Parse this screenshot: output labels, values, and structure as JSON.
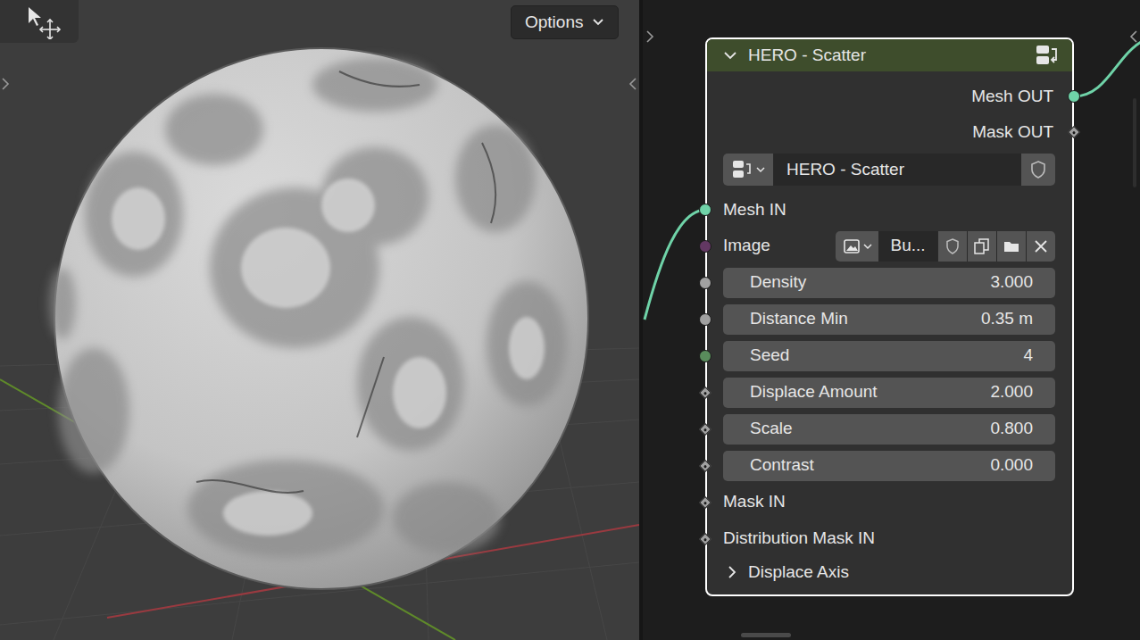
{
  "viewport": {
    "options": {
      "label": "Options"
    }
  },
  "node": {
    "title": "HERO - Scatter",
    "expanded": true,
    "selected": true,
    "outputs": [
      {
        "label": "Mesh OUT",
        "socket": "circle",
        "color": "#6fd3a8",
        "linked": true
      },
      {
        "label": "Mask OUT",
        "socket": "diamond",
        "color": "#a1a1a1",
        "linked": false
      }
    ],
    "group": {
      "name": "HERO - Scatter"
    },
    "inputs": [
      {
        "label": "Mesh IN",
        "kind": "socket",
        "socket": "circle",
        "color": "#6fd3a8",
        "linked": true
      },
      {
        "label": "Image",
        "kind": "image",
        "socket": "circle",
        "color": "#633863",
        "value": "Bu...",
        "linked": false
      },
      {
        "label": "Density",
        "kind": "field",
        "socket": "circle",
        "color": "#a1a1a1",
        "value": "3.000",
        "linked": false
      },
      {
        "label": "Distance Min",
        "kind": "field",
        "socket": "circle",
        "color": "#a1a1a1",
        "value": "0.35 m",
        "linked": false
      },
      {
        "label": "Seed",
        "kind": "field",
        "socket": "circle",
        "color": "#598c5c",
        "value": "4",
        "linked": false
      },
      {
        "label": "Displace Amount",
        "kind": "field",
        "socket": "diamond",
        "color": "#a1a1a1",
        "value": "2.000",
        "linked": false
      },
      {
        "label": "Scale",
        "kind": "field",
        "socket": "diamond",
        "color": "#a1a1a1",
        "value": "0.800",
        "linked": false
      },
      {
        "label": "Contrast",
        "kind": "field",
        "socket": "diamond",
        "color": "#a1a1a1",
        "value": "0.000",
        "linked": false
      },
      {
        "label": "Mask IN",
        "kind": "socket",
        "socket": "diamond",
        "color": "#a1a1a1",
        "linked": false
      },
      {
        "label": "Distribution Mask IN",
        "kind": "socket",
        "socket": "diamond",
        "color": "#a1a1a1",
        "linked": false
      }
    ],
    "panels": [
      {
        "label": "Displace Axis",
        "expanded": false
      }
    ]
  }
}
